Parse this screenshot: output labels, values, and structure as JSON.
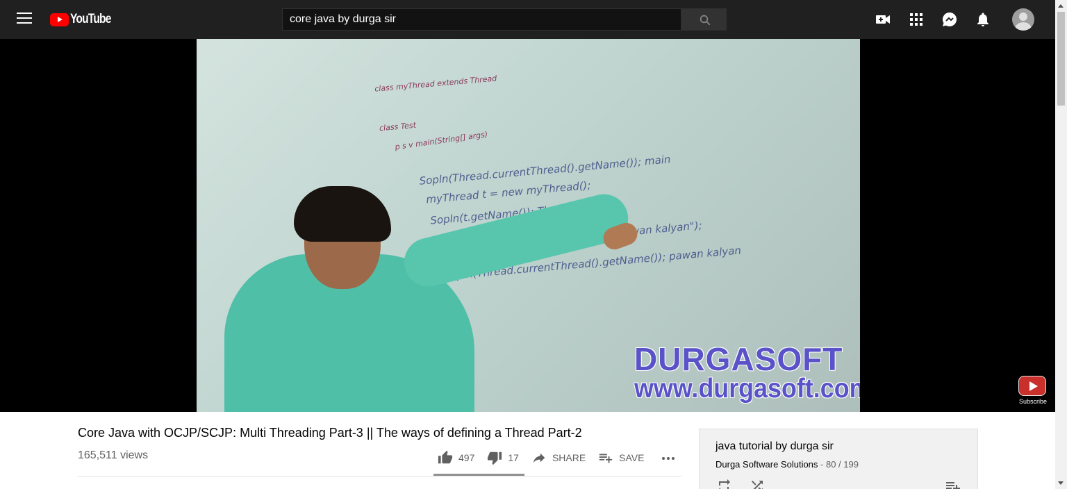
{
  "header": {
    "logo_text": "YouTube",
    "search_value": "core java by durga sir",
    "icons": [
      "menu-icon",
      "create-video-icon",
      "apps-icon",
      "messages-icon",
      "notifications-icon",
      "account-avatar"
    ]
  },
  "player": {
    "watermark_line1": "DURGASOFT",
    "watermark_line2": "www.durgasoft.com",
    "subscribe_label": "Subscribe",
    "board": {
      "line1": "class myThread extends Thread",
      "line2": "class Test",
      "line3": "p s v main(String[] args)",
      "line4": "Sopln(Thread.currentThread().getName()); main",
      "line5": "myThread t = new myThread();",
      "line6": "Sopln(t.getName()); Thread-0",
      "line7": "Thread.currentThread().setName(\"pawan kalyan\");",
      "line8": "Sopln(Thread.currentThread().getName()); pawan kalyan"
    }
  },
  "video": {
    "title": "Core Java with OCJP/SCJP: Multi Threading Part-3 || The ways of defining a Thread Part-2",
    "views": "165,511 views",
    "likes": "497",
    "dislikes": "17",
    "share_label": "SHARE",
    "save_label": "SAVE"
  },
  "playlist": {
    "title": "java tutorial by durga sir",
    "owner": "Durga Software Solutions",
    "position": " - 80 / 199"
  },
  "colors": {
    "header_bg": "#202020",
    "brand_red": "#ff0000",
    "text_primary": "#030303",
    "text_secondary": "#606060"
  }
}
